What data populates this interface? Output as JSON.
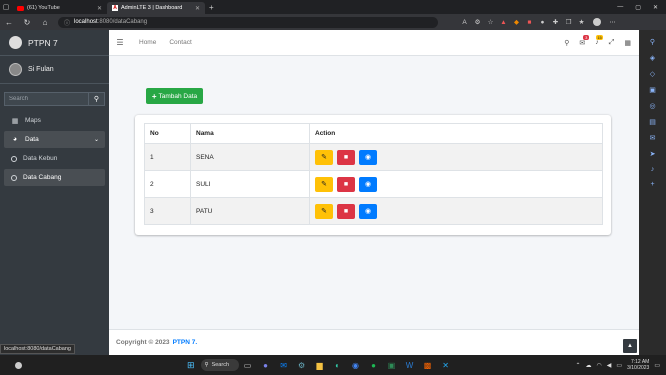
{
  "browser": {
    "tabs": [
      {
        "title": "(61) YouTube",
        "active": false
      },
      {
        "title": "AdminLTE 3 | Dashboard",
        "active": true
      }
    ],
    "url_host": "localhost",
    "url_path": ":8080/dataCabang",
    "status_url": "localhost:8080/dataCabang"
  },
  "sidebar": {
    "brand": "PTPN 7",
    "user": "Si Fulan",
    "search_placeholder": "Search",
    "items": [
      {
        "label": "Maps",
        "icon": "map-icon"
      },
      {
        "label": "Data",
        "icon": "pie-chart-icon",
        "open": true
      },
      {
        "label": "Data Kebun",
        "icon": "circle-icon"
      },
      {
        "label": "Data Cabang",
        "icon": "circle-icon",
        "active": true
      }
    ]
  },
  "navbar": {
    "links": [
      "Home",
      "Contact"
    ],
    "messages_badge": "3",
    "notifications_badge": "15"
  },
  "main": {
    "add_button": "Tambah Data",
    "table": {
      "headers": [
        "No",
        "Nama",
        "Action"
      ],
      "rows": [
        {
          "no": "1",
          "nama": "SENA"
        },
        {
          "no": "2",
          "nama": "SULI"
        },
        {
          "no": "3",
          "nama": "PATU"
        }
      ]
    }
  },
  "footer": {
    "text": "Copyright © 2023",
    "brand": "PTPN 7."
  },
  "taskbar": {
    "search_label": "Search",
    "time": "7:12 AM",
    "date": "3/10/2023"
  },
  "colors": {
    "sidebar": "#343a40",
    "success": "#28a745",
    "warning": "#ffc107",
    "danger": "#dc3545",
    "primary": "#007bff"
  }
}
